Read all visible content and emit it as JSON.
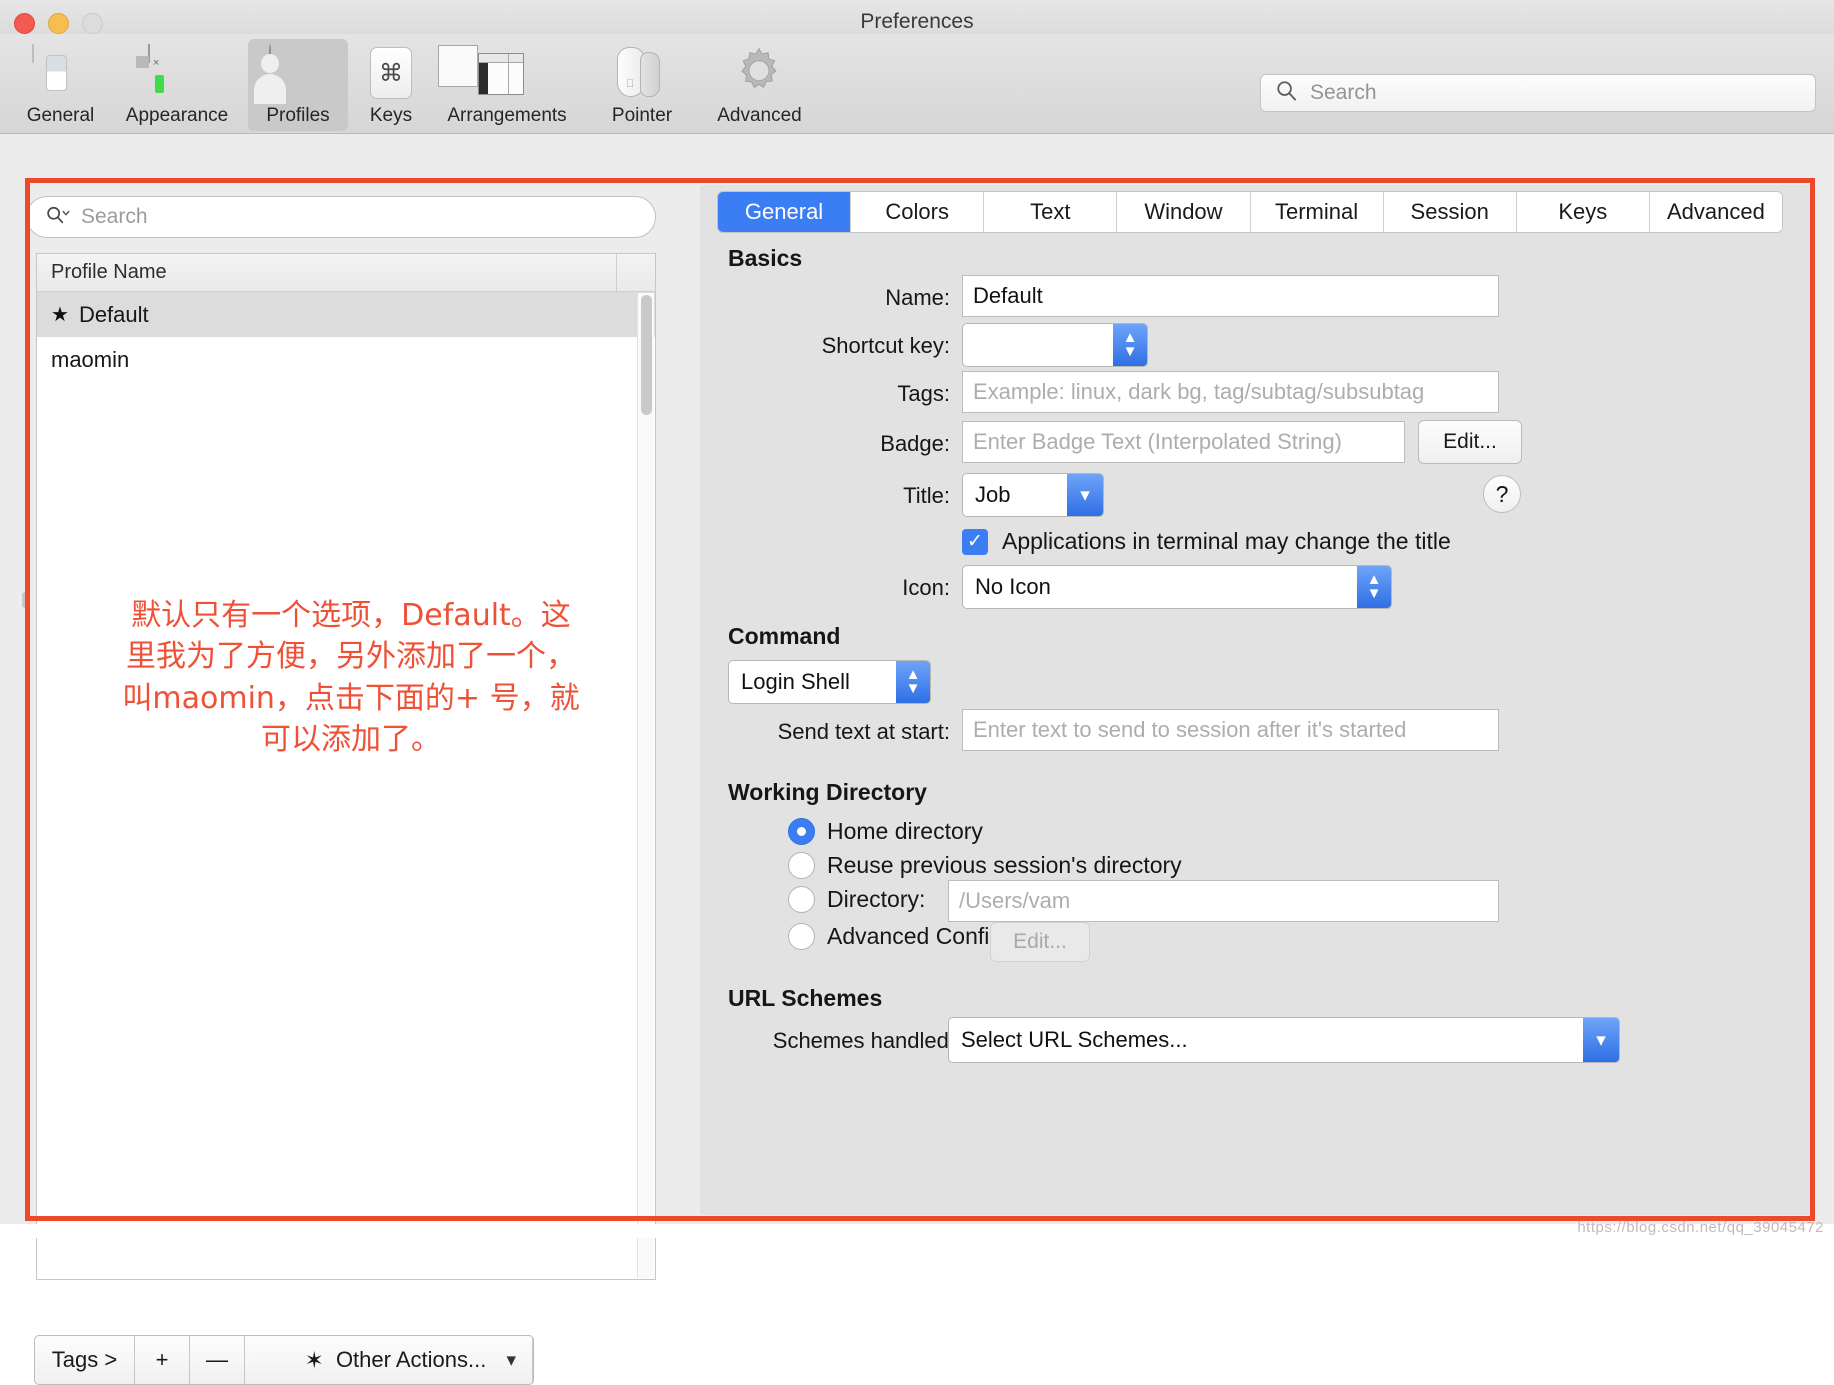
{
  "window": {
    "title": "Preferences",
    "traffic_lights": [
      "close",
      "minimize",
      "zoom"
    ]
  },
  "toolbar": {
    "items": [
      {
        "label": "General",
        "icon": "general-toggle-icon",
        "selected": false
      },
      {
        "label": "Appearance",
        "icon": "terminal-window-icon",
        "selected": false
      },
      {
        "label": "Profiles",
        "icon": "person-avatar-icon",
        "selected": true
      },
      {
        "label": "Keys",
        "icon": "command-key-icon",
        "selected": false
      },
      {
        "label": "Arrangements",
        "icon": "windows-stack-icon",
        "selected": false
      },
      {
        "label": "Pointer",
        "icon": "mouse-icon",
        "selected": false
      },
      {
        "label": "Advanced",
        "icon": "gear-icon",
        "selected": false
      }
    ],
    "search_placeholder": "Search",
    "search_value": "",
    "search_icon": "search-icon"
  },
  "sidebar": {
    "search_placeholder": "Search",
    "search_value": "",
    "search_icon": "search-dropdown-icon",
    "table_header": "Profile Name",
    "profiles": [
      {
        "name": "Default",
        "starred": true,
        "selected": true
      },
      {
        "name": "maomin",
        "starred": false,
        "selected": false
      }
    ],
    "annotation": "默认只有一个选项，Default。这\n里我为了方便，另外添加了一个，\n叫maomin，点击下面的+ 号，就\n可以添加了。",
    "bottom_bar": {
      "tags_label": "Tags >",
      "add_label": "+",
      "remove_label": "—",
      "other_actions_label": "Other Actions...",
      "gear_icon": "gear-icon",
      "chevron_icon": "chevron-down-icon"
    }
  },
  "main": {
    "tabs": [
      {
        "label": "General",
        "active": true
      },
      {
        "label": "Colors",
        "active": false
      },
      {
        "label": "Text",
        "active": false
      },
      {
        "label": "Window",
        "active": false
      },
      {
        "label": "Terminal",
        "active": false
      },
      {
        "label": "Session",
        "active": false
      },
      {
        "label": "Keys",
        "active": false
      },
      {
        "label": "Advanced",
        "active": false
      }
    ],
    "basics": {
      "heading": "Basics",
      "name_label": "Name:",
      "name_value": "Default",
      "shortcut_label": "Shortcut key:",
      "shortcut_value": "",
      "tags_label": "Tags:",
      "tags_placeholder": "Example: linux, dark bg, tag/subtag/subsubtag",
      "tags_value": "",
      "badge_label": "Badge:",
      "badge_placeholder": "Enter Badge Text (Interpolated String)",
      "badge_value": "",
      "badge_edit_label": "Edit...",
      "title_label": "Title:",
      "title_value": "Job",
      "help_label": "?",
      "app_title_checkbox_label": "Applications in terminal may change the title",
      "app_title_checked": true,
      "icon_label": "Icon:",
      "icon_value": "No Icon"
    },
    "command": {
      "heading": "Command",
      "shell_value": "Login Shell",
      "send_text_label": "Send text at start:",
      "send_text_placeholder": "Enter text to send to session after it's started",
      "send_text_value": ""
    },
    "working_directory": {
      "heading": "Working Directory",
      "options": [
        {
          "label": "Home directory",
          "selected": true
        },
        {
          "label": "Reuse previous session's directory",
          "selected": false
        },
        {
          "label": "Directory:",
          "selected": false
        },
        {
          "label": "Advanced Configuration",
          "selected": false
        }
      ],
      "directory_placeholder": "/Users/vam",
      "directory_value": "",
      "advanced_edit_label": "Edit..."
    },
    "url_schemes": {
      "heading": "URL Schemes",
      "schemes_label": "Schemes handled:",
      "schemes_value": "Select URL Schemes..."
    }
  },
  "watermark": "https://blog.csdn.net/qq_39045472",
  "colors": {
    "accent_blue": "#3b7ef4",
    "annotation_red": "#ef5136",
    "window_bg": "#ececec",
    "panel_bg": "#e2e2e2"
  }
}
